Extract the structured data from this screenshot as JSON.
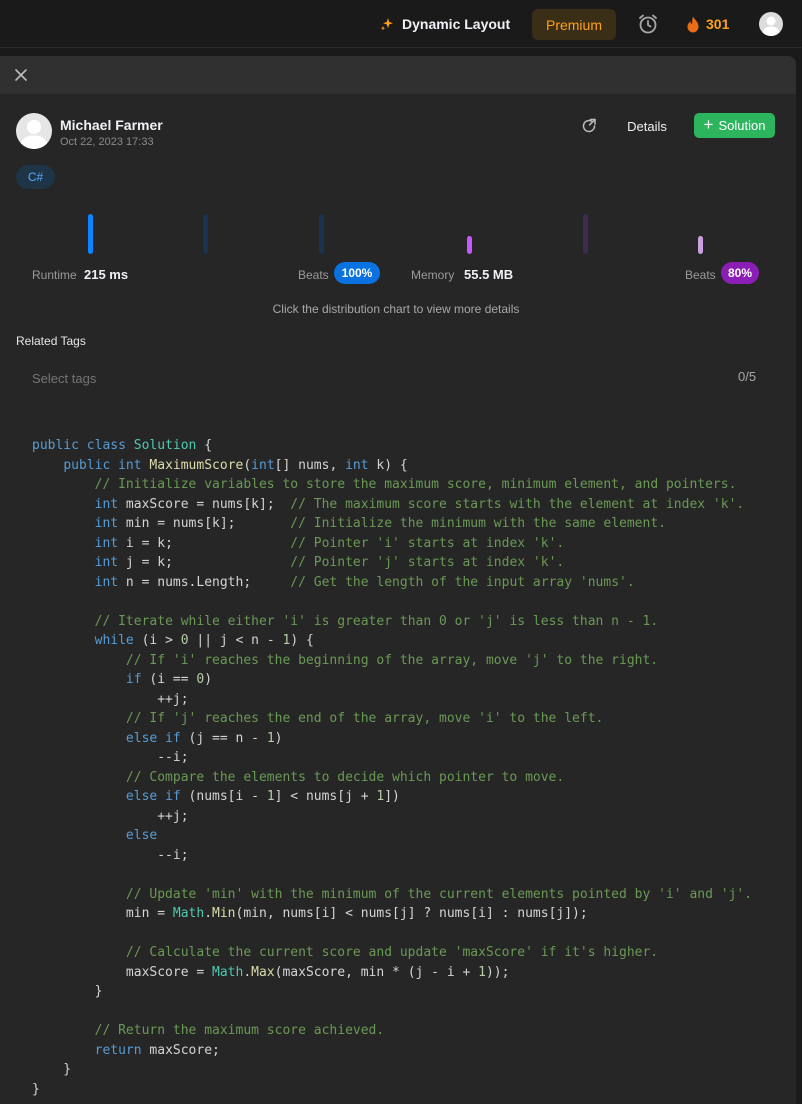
{
  "topbar": {
    "dynamic_layout_label": "Dynamic Layout",
    "premium_label": "Premium",
    "streak_count": "301",
    "accent_color": "#ffa116"
  },
  "submission": {
    "user_name": "Michael Farmer",
    "date": "Oct 22, 2023 17:33",
    "details_label": "Details",
    "solution_label": "Solution",
    "language": "C#"
  },
  "stats": {
    "runtime_label": "Runtime",
    "runtime_value": "215 ms",
    "runtime_beats_label": "Beats",
    "runtime_beats_value": "100%",
    "memory_label": "Memory",
    "memory_value": "55.5 MB",
    "memory_beats_label": "Beats",
    "memory_beats_value": "80%",
    "hint": "Click the distribution chart to view more details",
    "runtime_color": "#0a84ff",
    "memory_color": "#c359ff"
  },
  "tags": {
    "label": "Related Tags",
    "placeholder": "Select tags",
    "count": "0/5"
  },
  "code": {
    "language": "csharp",
    "lines": [
      "public class Solution {",
      "    public int MaximumScore(int[] nums, int k) {",
      "        // Initialize variables to store the maximum score, minimum element, and pointers.",
      "        int maxScore = nums[k];  // The maximum score starts with the element at index 'k'.",
      "        int min = nums[k];       // Initialize the minimum with the same element.",
      "        int i = k;               // Pointer 'i' starts at index 'k'.",
      "        int j = k;               // Pointer 'j' starts at index 'k'.",
      "        int n = nums.Length;     // Get the length of the input array 'nums'.",
      "",
      "        // Iterate while either 'i' is greater than 0 or 'j' is less than n - 1.",
      "        while (i > 0 || j < n - 1) {",
      "            // If 'i' reaches the beginning of the array, move 'j' to the right.",
      "            if (i == 0)",
      "                ++j;",
      "            // If 'j' reaches the end of the array, move 'i' to the left.",
      "            else if (j == n - 1)",
      "                --i;",
      "            // Compare the elements to decide which pointer to move.",
      "            else if (nums[i - 1] < nums[j + 1])",
      "                ++j;",
      "            else",
      "                --i;",
      "",
      "            // Update 'min' with the minimum of the current elements pointed by 'i' and 'j'.",
      "            min = Math.Min(min, nums[i] < nums[j] ? nums[i] : nums[j]);",
      "",
      "            // Calculate the current score and update 'maxScore' if it's higher.",
      "            maxScore = Math.Max(maxScore, min * (j - i + 1));",
      "        }",
      "",
      "        // Return the maximum score achieved.",
      "        return maxScore;",
      "    }",
      "}"
    ]
  }
}
